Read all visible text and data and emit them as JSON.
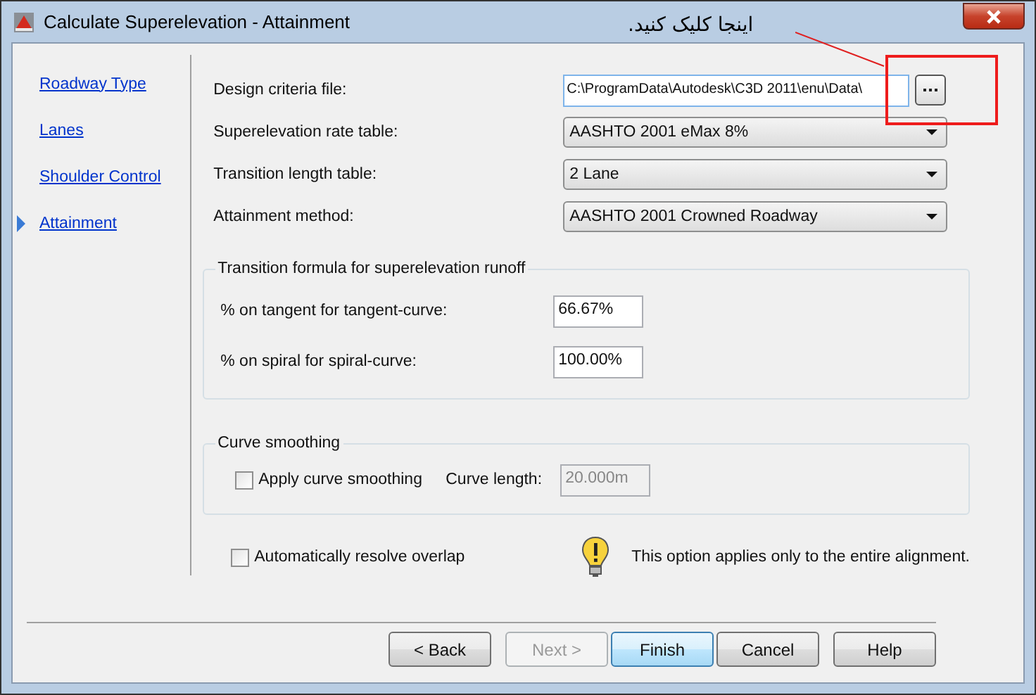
{
  "window": {
    "title": "Calculate Superelevation - Attainment"
  },
  "annotation": {
    "text": "اینجا کلیک کنید."
  },
  "steps": [
    {
      "label": "Roadway Type",
      "selected": false
    },
    {
      "label": "Lanes",
      "selected": false
    },
    {
      "label": "Shoulder Control",
      "selected": false
    },
    {
      "label": "Attainment",
      "selected": true
    }
  ],
  "settings": [
    {
      "kind": "file",
      "label": "Design criteria file:",
      "value": "C:\\ProgramData\\Autodesk\\C3D 2011\\enu\\Data\\"
    },
    {
      "kind": "dropdown",
      "label": "Superelevation rate table:",
      "value": "AASHTO 2001 eMax 8%"
    },
    {
      "kind": "dropdown",
      "label": "Transition length table:",
      "value": "2 Lane"
    },
    {
      "kind": "dropdown",
      "label": "Attainment method:",
      "value": "AASHTO 2001 Crowned Roadway"
    }
  ],
  "transition_formula": {
    "title": "Transition formula for superelevation runoff",
    "fields": [
      {
        "label": "% on tangent for tangent-curve:",
        "value": "66.67%"
      },
      {
        "label": "% on spiral for spiral-curve:",
        "value": "100.00%"
      }
    ]
  },
  "curve_smoothing": {
    "title": "Curve smoothing",
    "checkbox": {
      "label": "Apply curve smoothing",
      "checked": false
    },
    "length": {
      "label": "Curve length:",
      "value": "20.000m",
      "disabled": true
    }
  },
  "overlap": {
    "label": "Automatically resolve overlap",
    "checked": false
  },
  "note": "This option applies only to the entire alignment.",
  "buttons": [
    {
      "label": "< Back",
      "disabled": false,
      "default": false
    },
    {
      "label": "Next >",
      "disabled": true,
      "default": false
    },
    {
      "label": "Finish",
      "disabled": false,
      "default": true
    },
    {
      "label": "Cancel",
      "disabled": false,
      "default": false
    },
    {
      "label": "Help",
      "disabled": false,
      "default": false
    }
  ]
}
